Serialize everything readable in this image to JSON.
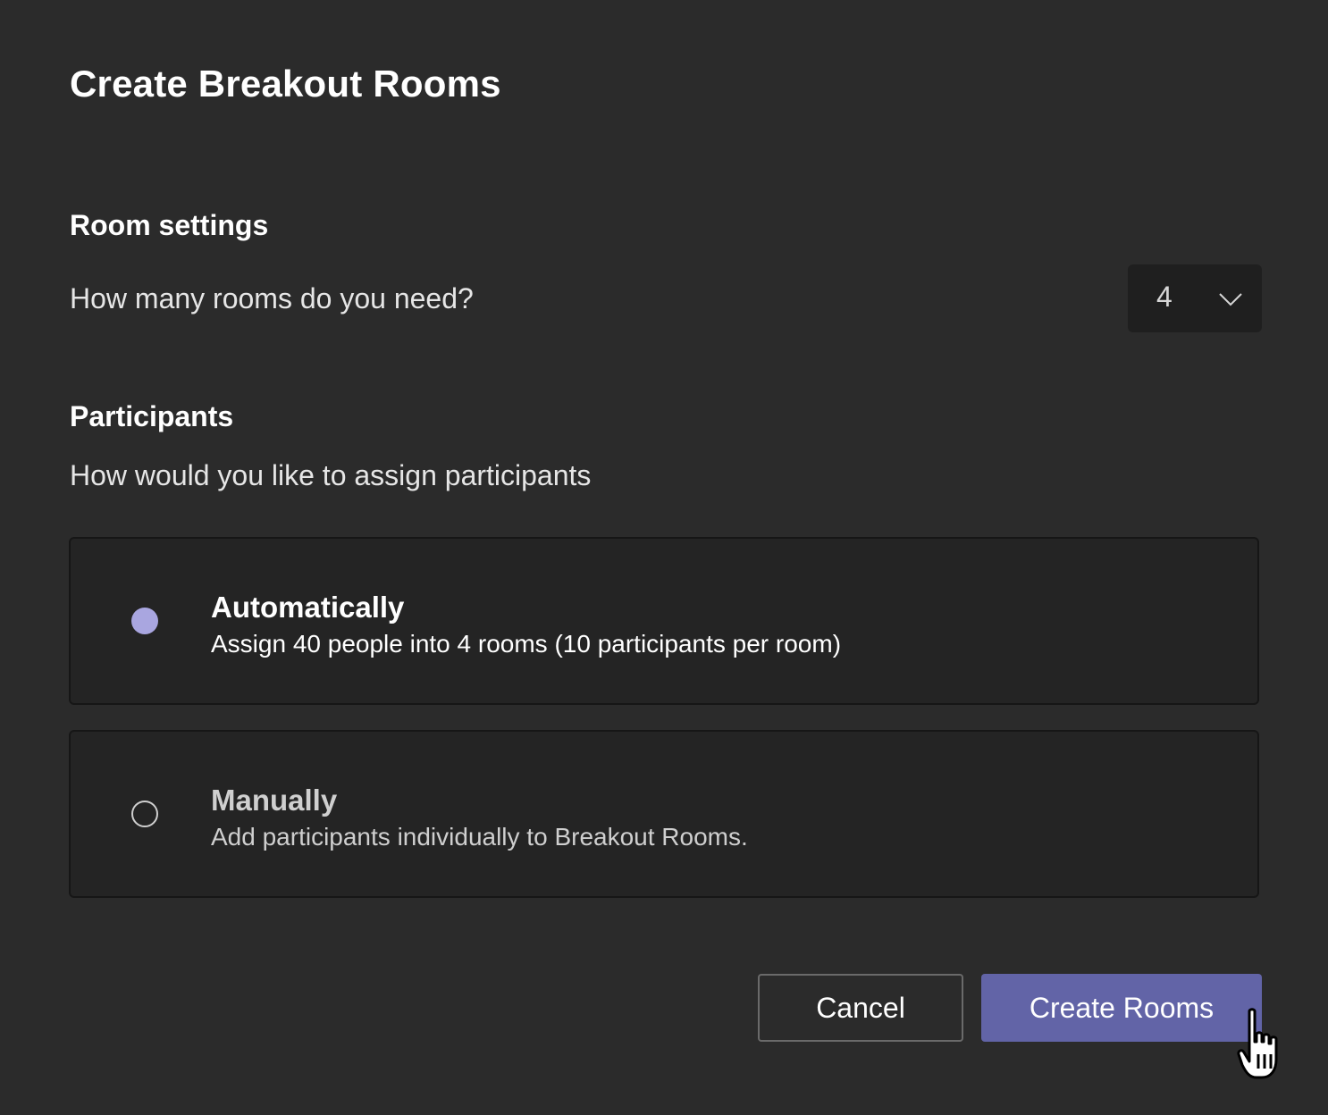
{
  "dialog": {
    "title": "Create Breakout Rooms"
  },
  "room_settings": {
    "heading": "Room settings",
    "question": "How many rooms do you need?",
    "rooms_select": {
      "value": "4",
      "icon": "chevron-down-icon"
    }
  },
  "participants": {
    "heading": "Participants",
    "question": "How would you like to assign participants",
    "options": [
      {
        "title": "Automatically",
        "description": "Assign 40 people into 4 rooms (10 participants per room)",
        "selected": true
      },
      {
        "title": "Manually",
        "description": "Add participants individually to Breakout Rooms.",
        "selected": false
      }
    ]
  },
  "actions": {
    "cancel_label": "Cancel",
    "create_label": "Create Rooms"
  },
  "colors": {
    "background": "#2b2b2b",
    "accent": "#6264a7",
    "radio_selected": "#a9a6e0"
  },
  "cursor": {
    "icon": "hand-pointer-icon"
  }
}
